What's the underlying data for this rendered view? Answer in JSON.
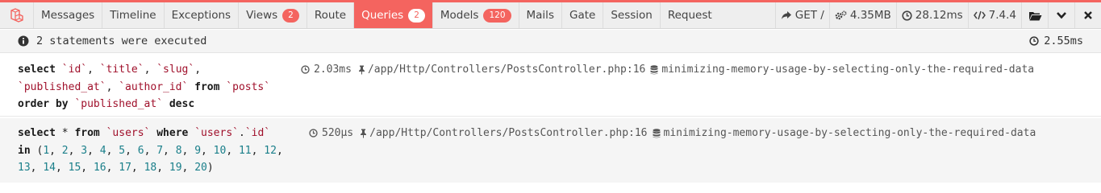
{
  "colors": {
    "accent": "#f4645f",
    "toolbar_bg": "#eeeeee",
    "keyword": "#1a1a1a",
    "string": "#a0102b",
    "number": "#1a7f8a"
  },
  "toolbar": {
    "logo": "laravel-logo-icon",
    "tabs": [
      {
        "label": "Messages"
      },
      {
        "label": "Timeline"
      },
      {
        "label": "Exceptions"
      },
      {
        "label": "Views",
        "badge": "2"
      },
      {
        "label": "Route"
      },
      {
        "label": "Queries",
        "badge": "2",
        "active": true
      },
      {
        "label": "Models",
        "badge": "120"
      },
      {
        "label": "Mails"
      },
      {
        "label": "Gate"
      },
      {
        "label": "Session"
      },
      {
        "label": "Request"
      }
    ],
    "indicators": {
      "request": "GET /",
      "memory": "4.35MB",
      "duration": "28.12ms",
      "php_version": "7.4.4"
    },
    "controls": [
      "folder-open-icon",
      "chevron-down-icon",
      "close-icon"
    ]
  },
  "queries": {
    "summary": "2 statements were executed",
    "total_duration": "2.55ms",
    "statements": [
      {
        "duration": "2.03ms",
        "source": "/app/Http/Controllers/PostsController.php:16",
        "connection": "minimizing-memory-usage-by-selecting-only-the-required-data",
        "tokens": {
          "t1": "select",
          "t2": "`id`",
          "t3": ", ",
          "t4": "`title`",
          "t5": ", ",
          "t6": "`slug`",
          "t7": ",",
          "t8": "`published_at`",
          "t9": ", ",
          "t10": "`author_id`",
          "t11": "from",
          "t12": "`posts`",
          "t13": "order by",
          "t14": "`published_at`",
          "t15": "desc"
        }
      },
      {
        "duration": "520μs",
        "source": "/app/Http/Controllers/PostsController.php:16",
        "connection": "minimizing-memory-usage-by-selecting-only-the-required-data",
        "tokens": {
          "t1": "select",
          "t2": "*",
          "t3": "from",
          "t4": "`users`",
          "t5": "where",
          "t6": "`users`",
          "t7": ".",
          "t8": "`id`",
          "t9": "in",
          "t10": "("
        },
        "ids": [
          "1",
          "2",
          "3",
          "4",
          "5",
          "6",
          "7",
          "8",
          "9",
          "10",
          "11",
          "12",
          "13",
          "14",
          "15",
          "16",
          "17",
          "18",
          "19",
          "20"
        ],
        "close": ")"
      }
    ]
  }
}
